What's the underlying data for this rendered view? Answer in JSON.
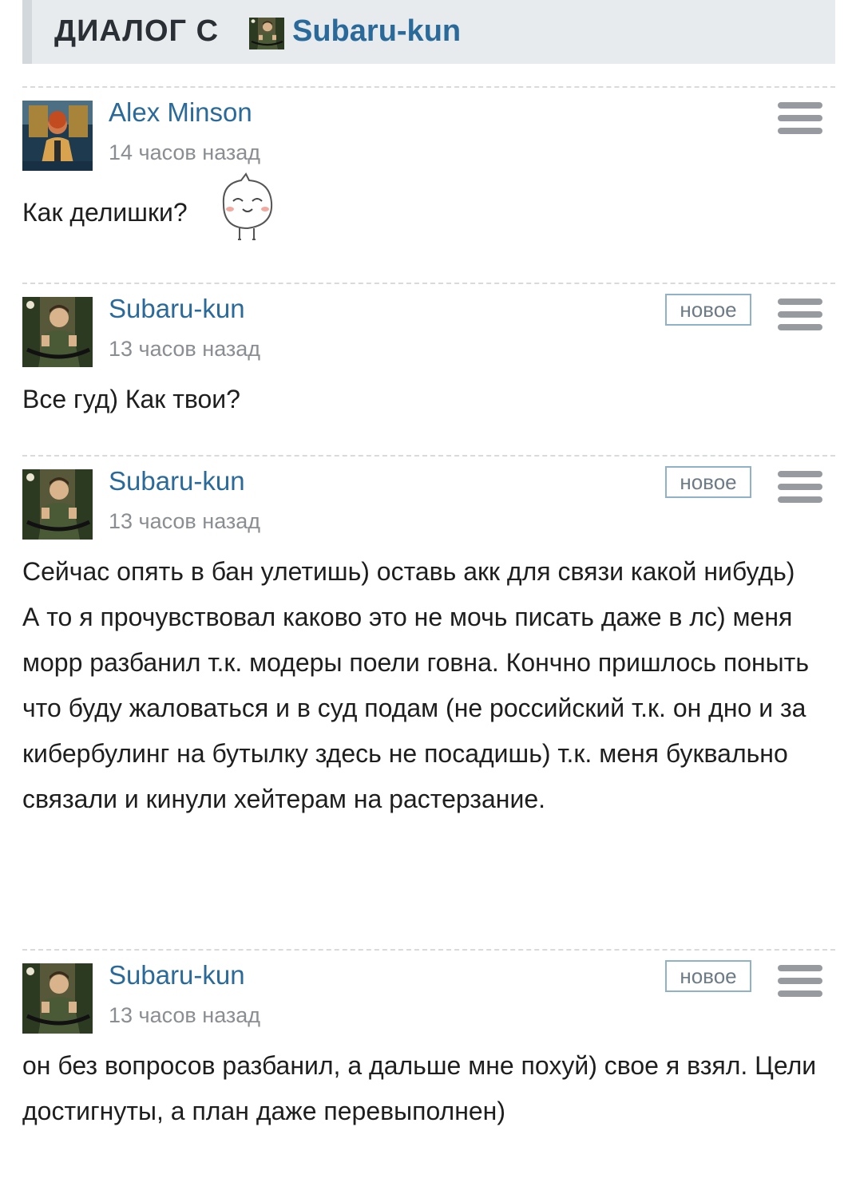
{
  "header": {
    "title": "ДИАЛОГ С",
    "user": "Subaru-kun"
  },
  "messages": [
    {
      "author": "Alex Minson",
      "time": "14 часов назад",
      "badge": "",
      "lines": [
        "Как делишки?"
      ]
    },
    {
      "author": "Subaru-kun",
      "time": "13 часов назад",
      "badge": "новое",
      "lines": [
        "Все гуд) Как твои?"
      ]
    },
    {
      "author": "Subaru-kun",
      "time": "13 часов назад",
      "badge": "новое",
      "lines": [
        "Сейчас опять в бан улетишь) оставь акк для связи какой нибудь)",
        "А то я прочувствовал каково это не мочь писать даже в лс) меня морр разбанил т.к. модеры поели говна. Кончно пришлось поныть что буду жаловаться и в суд подам (не российский т.к. он дно и за кибербулинг на бутылку здесь не посадишь) т.к. меня буквально связали и кинули хейтерам на растерзание."
      ]
    },
    {
      "author": "Subaru-kun",
      "time": "13 часов назад",
      "badge": "новое",
      "lines": [
        "он без вопросов разбанил, а дальше мне похуй) свое я взял. Цели достигнуты, а план даже перевыполнен)"
      ]
    }
  ],
  "icons": {
    "menu": "hamburger-menu-icon",
    "sticker": "smiling-face-sticker-icon"
  },
  "colors": {
    "link": "#2a6a9a",
    "header_bg": "#e8ebee",
    "muted": "#8a8d91",
    "badge_border": "#8fb2c8"
  }
}
